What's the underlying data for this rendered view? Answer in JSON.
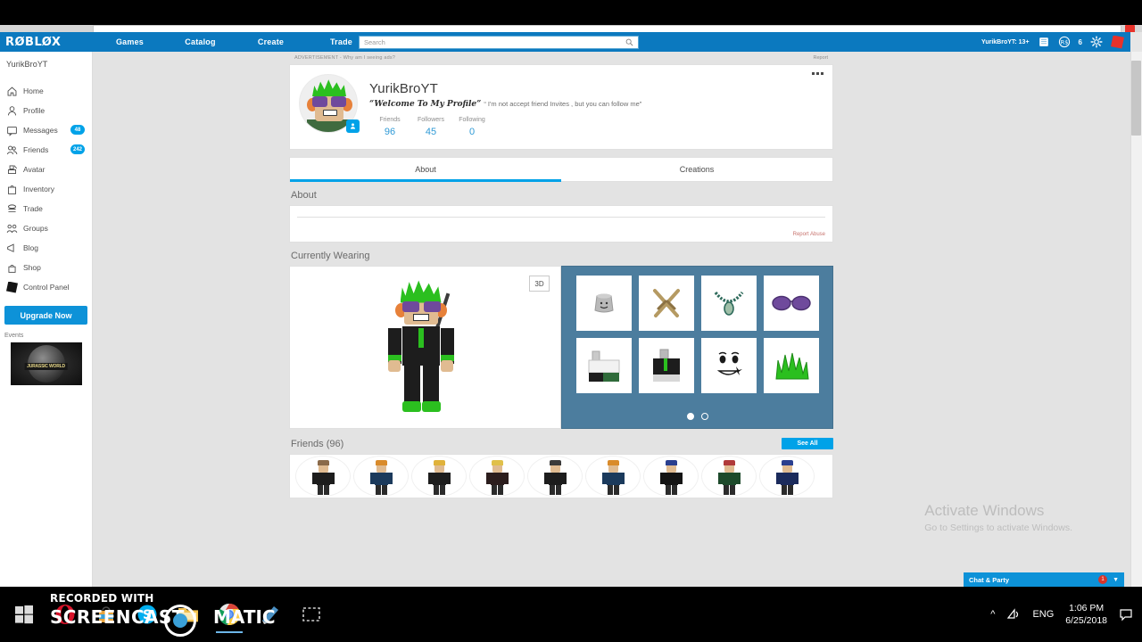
{
  "header": {
    "logo": "RØBLØX",
    "nav": [
      {
        "label": "Games"
      },
      {
        "label": "Catalog"
      },
      {
        "label": "Create"
      },
      {
        "label": "Trade"
      }
    ],
    "search_placeholder": "Search",
    "search_value": "",
    "search_icon": "search-icon",
    "username_age": "YurikBroYT: 13+",
    "messages_icon": "messages-icon",
    "robux_icon": "robux-icon",
    "robux_count": "6",
    "settings_icon": "gear-icon",
    "notification_logo": "roblox-logo-icon"
  },
  "sidebar": {
    "username": "YurikBroYT",
    "items": [
      {
        "label": "Home",
        "icon": "home-icon",
        "badge": ""
      },
      {
        "label": "Profile",
        "icon": "person-icon",
        "badge": ""
      },
      {
        "label": "Messages",
        "icon": "message-icon",
        "badge": "48"
      },
      {
        "label": "Friends",
        "icon": "friends-icon",
        "badge": "242"
      },
      {
        "label": "Avatar",
        "icon": "avatar-icon",
        "badge": ""
      },
      {
        "label": "Inventory",
        "icon": "inventory-icon",
        "badge": ""
      },
      {
        "label": "Trade",
        "icon": "trade-icon",
        "badge": ""
      },
      {
        "label": "Groups",
        "icon": "groups-icon",
        "badge": ""
      },
      {
        "label": "Blog",
        "icon": "blog-icon",
        "badge": ""
      },
      {
        "label": "Shop",
        "icon": "shop-icon",
        "badge": ""
      },
      {
        "label": "Control Panel",
        "icon": "control-panel-icon",
        "badge": ""
      }
    ],
    "upgrade_label": "Upgrade Now",
    "events_label": "Events",
    "event_thumb_title": "JURASSIC WORLD"
  },
  "advertisement": {
    "label": "ADVERTISEMENT - Why am I seeing ads?",
    "report_label": "Report"
  },
  "profile": {
    "name": "YurikBroYT",
    "status_fancy": "“Welcome To My Profile”",
    "status_rest": "“ I'm not accept friend Invites , but you can follow me”",
    "avatar_badge_icon": "person-badge-icon",
    "menu_icon": "overflow-menu-icon",
    "stats": [
      {
        "label": "Friends",
        "value": "96"
      },
      {
        "label": "Followers",
        "value": "45"
      },
      {
        "label": "Following",
        "value": "0"
      }
    ]
  },
  "tabs": [
    {
      "label": "About",
      "active": true
    },
    {
      "label": "Creations",
      "active": false
    }
  ],
  "about": {
    "section_title": "About",
    "body_text": "",
    "report_abuse_label": "Report Abuse"
  },
  "currently_wearing": {
    "section_title": "Currently Wearing",
    "view_3d_label": "3D",
    "items": [
      {
        "name": "smiley-bucket-hat"
      },
      {
        "name": "crossed-swords"
      },
      {
        "name": "jade-necklace"
      },
      {
        "name": "purple-sunglasses"
      },
      {
        "name": "white-shirt"
      },
      {
        "name": "black-green-jacket"
      },
      {
        "name": "winking-face"
      },
      {
        "name": "green-spiky-hair"
      }
    ],
    "carousel_dots": 2,
    "carousel_active_index": 0
  },
  "friends": {
    "title": "Friends (96)",
    "see_all_label": "See All",
    "avatars": [
      {
        "hair": "#8a6a4a",
        "shirt": "#1d1d1d"
      },
      {
        "hair": "#d98b2b",
        "shirt": "#1b3a5c"
      },
      {
        "hair": "#e0b23a",
        "shirt": "#1d1d1d"
      },
      {
        "hair": "#e0c04a",
        "shirt": "#2b1d1d"
      },
      {
        "hair": "#3a3a3a",
        "shirt": "#1d1d1d"
      },
      {
        "hair": "#d98b2b",
        "shirt": "#1b3a5c"
      },
      {
        "hair": "#2a3f8f",
        "shirt": "#141414"
      },
      {
        "hair": "#b03a3a",
        "shirt": "#1d4a2b"
      },
      {
        "hair": "#2a3f8f",
        "shirt": "#1b2b5c"
      }
    ]
  },
  "chat": {
    "label": "Chat & Party",
    "badge": "1",
    "chevron_icon": "chevron-up-icon"
  },
  "windows_watermark": {
    "title": "Activate Windows",
    "subtitle": "Go to Settings to activate Windows."
  },
  "recorder_watermark": {
    "top_line": "RECORDED WITH",
    "main_line": "SCREENCAST",
    "secondary_line": "MATIC"
  },
  "taskbar": {
    "icons": [
      {
        "name": "windows-start-icon"
      },
      {
        "name": "opera-icon"
      },
      {
        "name": "microsoft-store-icon"
      },
      {
        "name": "skype-icon"
      },
      {
        "name": "file-explorer-icon"
      },
      {
        "name": "google-chrome-icon"
      },
      {
        "name": "notepad-icon"
      },
      {
        "name": "snip-tool-icon"
      }
    ],
    "tray": {
      "chevron_icon": "show-hidden-icons-icon",
      "network_icon": "network-icon",
      "language": "ENG",
      "time": "1:06 PM",
      "date": "6/25/2018",
      "action_center_icon": "action-center-icon"
    }
  },
  "colors": {
    "roblox_blue": "#0b79bf",
    "accent_blue": "#00a2e8",
    "panel_blue": "#4c7d9e",
    "page_bg": "#e3e3e3",
    "badge_red": "#d6342b"
  }
}
